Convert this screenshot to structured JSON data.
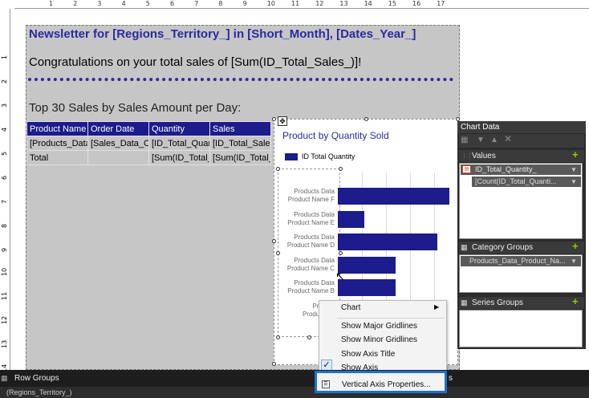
{
  "ruler": {
    "horizontal": [
      "1",
      "2",
      "3",
      "4",
      "5",
      "6",
      "7",
      "8",
      "9",
      "10",
      "11",
      "12",
      "13",
      "14",
      "15",
      "16",
      "17"
    ],
    "vertical": [
      "1",
      "2",
      "3",
      "4",
      "5",
      "6",
      "7",
      "8",
      "9",
      "10",
      "11",
      "12",
      "13",
      "14"
    ]
  },
  "report": {
    "newsletter_title": "Newsletter for [Regions_Territory_] in [Short_Month], [Dates_Year_]",
    "congrats_text": "Congratulations on your total sales of [Sum(ID_Total_Sales_)]!",
    "table_title": "Top 30 Sales by Sales Amount per Day:",
    "tablix": {
      "headers": [
        "Product Name",
        "Order Date",
        "Quantity",
        "Sales"
      ],
      "rows": [
        [
          "[Products_Data",
          "[Sales_Data_Or",
          "[ID_Total_Quant",
          "[ID_Total_Sales"
        ],
        [
          "Total",
          "",
          "[Sum(ID_Total_(",
          "[Sum(ID_Total_"
        ]
      ]
    }
  },
  "chart": {
    "title": "Product by Quantity Sold",
    "legend": "ID Total Quantity",
    "bar_color": "#1c1c8c",
    "categories": [
      [
        "Products Data",
        "Product Name  F"
      ],
      [
        "Products Data",
        "Product Name  E"
      ],
      [
        "Products Data",
        "Product Name  D"
      ],
      [
        "Products Data",
        "Product Name  C"
      ],
      [
        "Products Data",
        "Product Name  B"
      ],
      [
        "Product",
        "Product Na"
      ]
    ],
    "bar_fractions": [
      1.0,
      0.24,
      0.89,
      0.52,
      0.52
    ]
  },
  "chart_data_panel": {
    "title": "Chart Data",
    "values_label": "Values",
    "values_field": "ID_Total_Quantity_",
    "values_subfield": "[Count(ID_Total_Quanti...",
    "category_groups_label": "Category Groups",
    "category_field": "Products_Data_Product_Na...",
    "series_groups_label": "Series Groups",
    "accent": "#8fd000"
  },
  "context_menu": {
    "chart": "Chart",
    "major_gridlines": "Show Major Gridlines",
    "minor_gridlines": "Show Minor Gridlines",
    "axis_title": "Show Axis Title",
    "show_axis": "Show Axis",
    "vertical_axis_props": "Vertical Axis Properties...",
    "highlight_color": "#1e6fd0"
  },
  "bottom": {
    "row_groups": "Row Groups",
    "row_group_item": "(Regions_Territory_)",
    "column_groups_fragment": "s"
  }
}
